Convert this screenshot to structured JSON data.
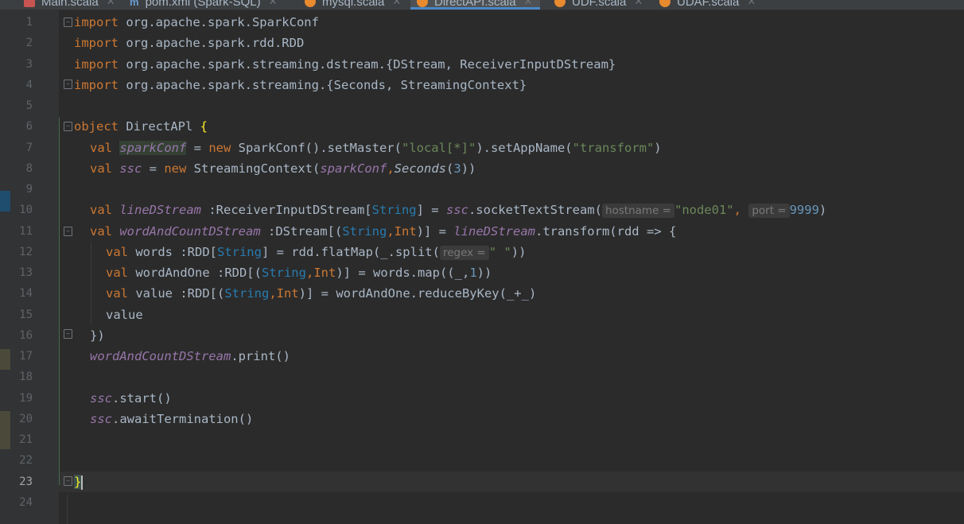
{
  "tabs": [
    {
      "label": "Main.scala",
      "icon": "scala-red-icon"
    },
    {
      "label": "pom.xml (Spark-SQL)",
      "icon": "maven-icon"
    },
    {
      "label": "mysql.scala",
      "icon": "scala-object-icon"
    },
    {
      "label": "DirectAPI.scala",
      "icon": "scala-object-icon",
      "active": true
    },
    {
      "label": "UDF.scala",
      "icon": "scala-object-icon"
    },
    {
      "label": "UDAF.scala",
      "icon": "scala-object-icon"
    }
  ],
  "line_numbers": [
    "1",
    "2",
    "3",
    "4",
    "5",
    "6",
    "7",
    "8",
    "9",
    "10",
    "11",
    "12",
    "13",
    "14",
    "15",
    "16",
    "17",
    "18",
    "19",
    "20",
    "21",
    "22",
    "23",
    "24"
  ],
  "code": {
    "l1": {
      "kw": "import",
      "rest": " org.apache.spark.SparkConf"
    },
    "l2": {
      "kw": "import",
      "rest": " org.apache.spark.rdd.RDD"
    },
    "l3": {
      "kw": "import",
      "rest": " org.apache.spark.streaming.dstream.{DStream, ReceiverInputDStream}"
    },
    "l4": {
      "kw": "import",
      "rest": " org.apache.spark.streaming.{Seconds, StreamingContext}"
    },
    "l6": {
      "kw": "object",
      "name": " DirectAPl ",
      "brace": "{"
    },
    "l7": {
      "val": "val",
      "var": "sparkConf",
      "eq": " = ",
      "new": "new",
      "call": " SparkConf().setMaster(",
      "s1": "\"local[*]\"",
      "mid": ").setAppName(",
      "s2": "\"transform\"",
      "end": ")"
    },
    "l8": {
      "val": "val",
      "var": "ssc",
      "eq": " = ",
      "new": "new",
      "call": " StreamingContext(",
      "a1": "sparkConf",
      "comma": ",",
      "a2": "Seconds",
      "open": "(",
      "n": "3",
      "end": "))"
    },
    "l10": {
      "val": "val",
      "var": "lineDStream",
      "type1": " :ReceiverInputDStream[",
      "type2": "String",
      "mid": "] = ",
      "ssc": "ssc",
      "call": ".socketTextStream(",
      "hint1": "hostname =",
      "s1": "\"node01\"",
      "comma": ", ",
      "hint2": "port =",
      "n": "9999",
      "end": ")"
    },
    "l11": {
      "val": "val",
      "var": "wordAndCountDStream",
      "t1": " :DStream[(",
      "t2": "String",
      "c": ",",
      "t3": "Int",
      "t4": ")] = ",
      "ref": "lineDStream",
      "end": ".transform(rdd => {"
    },
    "l12": {
      "val": "val",
      "rest1": " words :RDD[",
      "t": "String",
      "rest2": "] = rdd.flatMap(_.split(",
      "hint": "regex =",
      "s": "\" \"",
      "end": "))"
    },
    "l13": {
      "val": "val",
      "rest1": " wordAndOne :RDD[(",
      "t1": "String",
      "c": ",",
      "t2": "Int",
      "rest2": ")] = words.map((_,",
      "n": "1",
      "end": "))"
    },
    "l14": {
      "val": "val",
      "rest1": " value :RDD[(",
      "t1": "String",
      "c": ",",
      "t2": "Int",
      "rest2": ")] = wordAndOne.reduceByKey(_+_)"
    },
    "l15": {
      "text": "value"
    },
    "l16": {
      "text": "})"
    },
    "l17": {
      "ref": "wordAndCountDStream",
      "end": ".print()"
    },
    "l19": {
      "ref": "ssc",
      "end": ".start()"
    },
    "l20": {
      "ref": "ssc",
      "end": ".awaitTermination()"
    },
    "l23": {
      "brace": "}"
    }
  },
  "colors": {
    "keyword": "#cc7832",
    "string": "#6a8759",
    "number": "#6897bb",
    "field": "#9876aa",
    "background": "#2b2b2b"
  }
}
